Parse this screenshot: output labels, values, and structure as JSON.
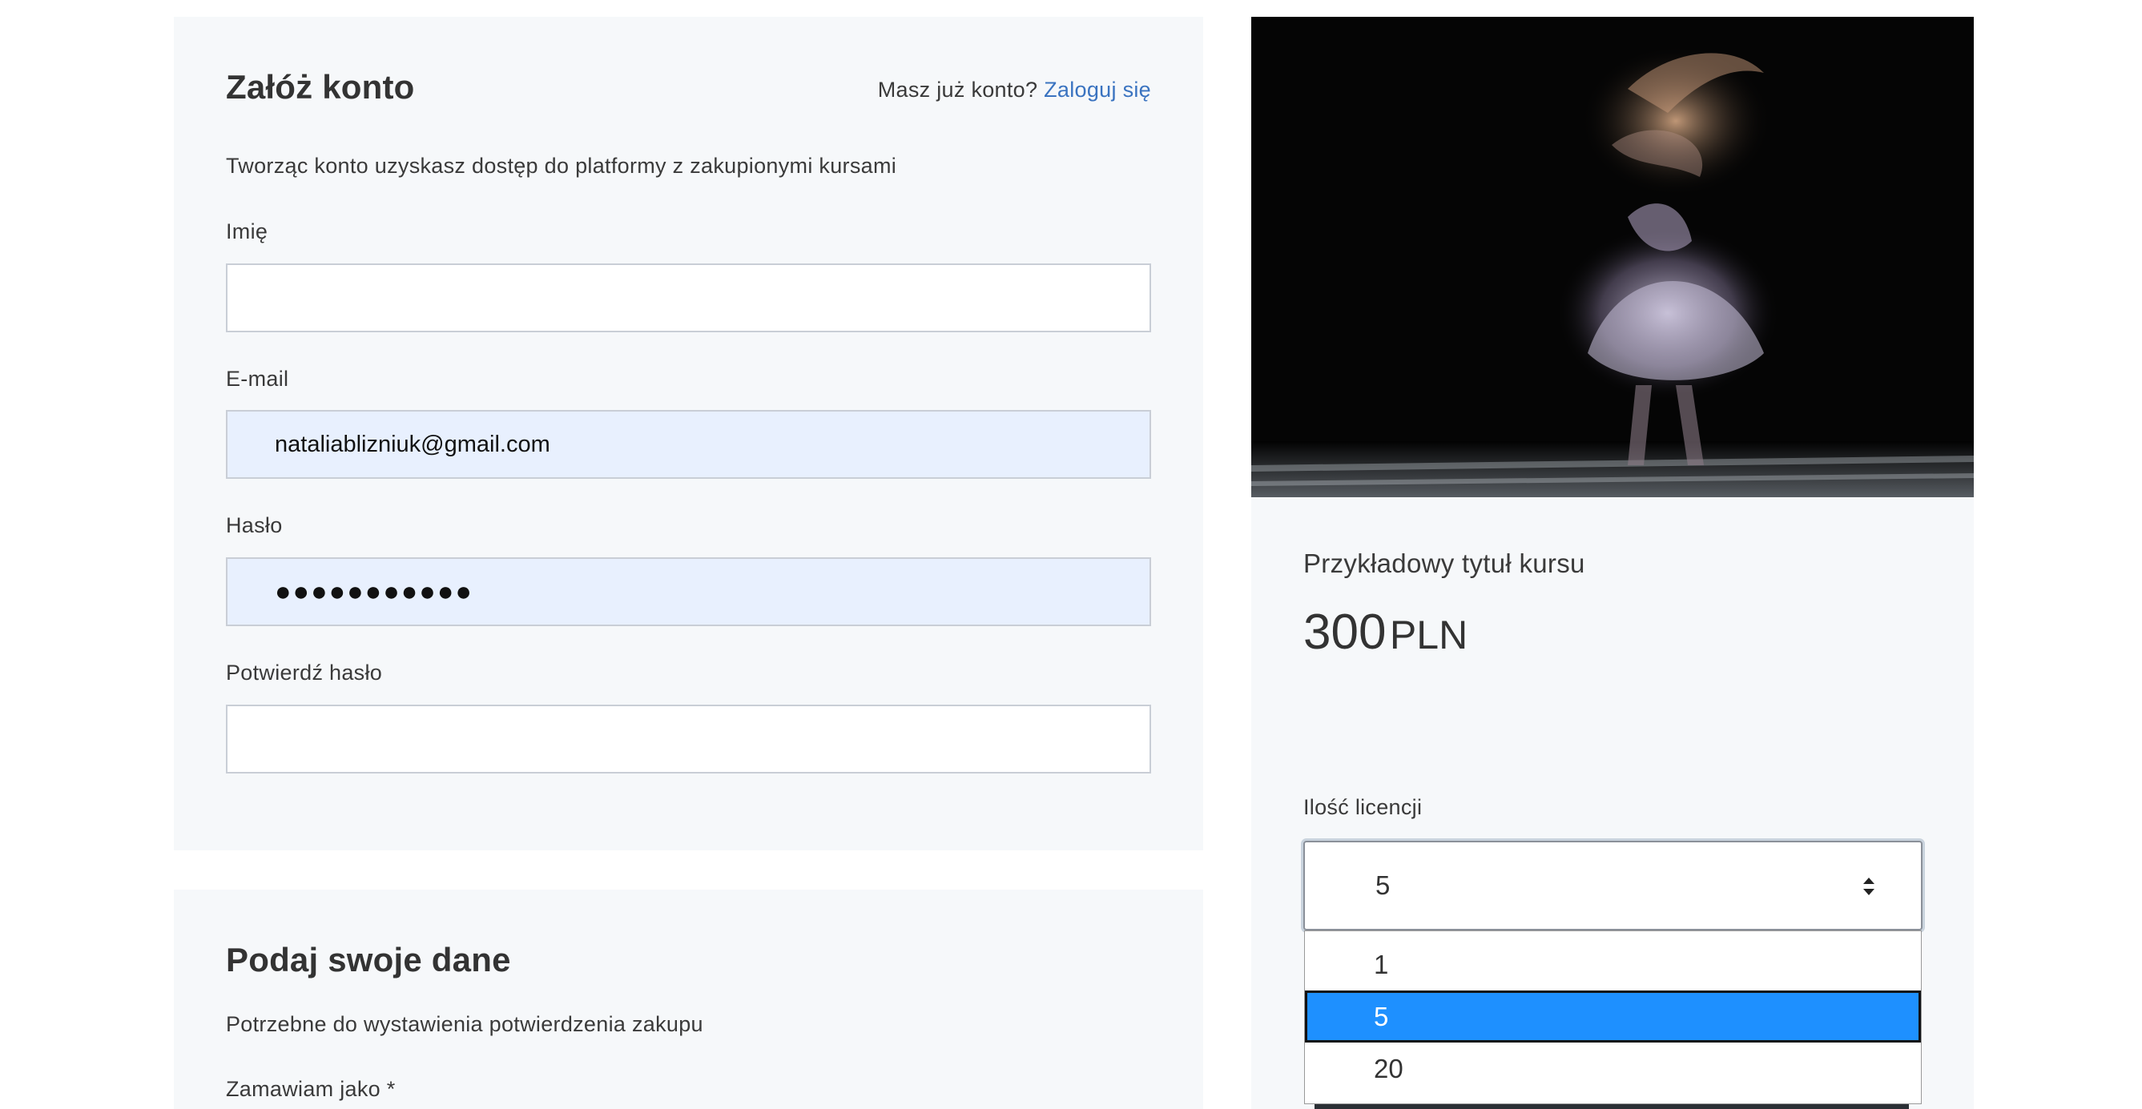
{
  "register": {
    "title": "Załóż konto",
    "have_account": "Masz już konto?",
    "login_link": "Zaloguj się",
    "description": "Tworząc konto uzyskasz dostęp do platformy z zakupionymi kursami",
    "first_name_label": "Imię",
    "first_name_value": "",
    "email_label": "E-mail",
    "email_value": "nataliablizniuk@gmail.com",
    "password_label": "Hasło",
    "password_value": "●●●●●●●●●●●",
    "confirm_password_label": "Potwierdź hasło",
    "confirm_password_value": ""
  },
  "details": {
    "title": "Podaj swoje dane",
    "description": "Potrzebne do wystawienia potwierdzenia zakupu",
    "order_as_label": "Zamawiam jako *"
  },
  "course": {
    "title": "Przykładowy tytuł kursu",
    "price_amount": "300",
    "price_currency": "PLN",
    "licenses_label": "Ilość licencji",
    "licenses_selected": "5",
    "licenses_options": [
      "1",
      "5",
      "20"
    ],
    "colors": {
      "selected_option": "#1e90ff",
      "link": "#3a73c0",
      "panel": "#f6f8fa"
    }
  }
}
